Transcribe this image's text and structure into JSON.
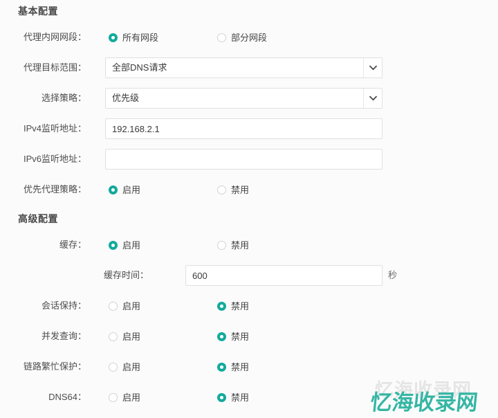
{
  "sections": {
    "basic": {
      "title": "基本配置",
      "rows": {
        "proxy_lan": {
          "label": "代理内网网段：",
          "options": [
            {
              "label": "所有网段",
              "selected": true
            },
            {
              "label": "部分网段",
              "selected": false
            }
          ]
        },
        "proxy_target": {
          "label": "代理目标范围：",
          "value": "全部DNS请求",
          "arrow_icon": "chevron-down-icon"
        },
        "policy": {
          "label": "选择策略：",
          "value": "优先级",
          "arrow_icon": "chevron-down-icon"
        },
        "ipv4": {
          "label": "IPv4监听地址：",
          "value": "192.168.2.1",
          "placeholder": ""
        },
        "ipv6": {
          "label": "IPv6监听地址：",
          "value": "",
          "placeholder": ""
        },
        "priority_proxy": {
          "label": "优先代理策略：",
          "options": [
            {
              "label": "启用",
              "selected": true
            },
            {
              "label": "禁用",
              "selected": false
            }
          ]
        }
      }
    },
    "advanced": {
      "title": "高级配置",
      "rows": {
        "cache": {
          "label": "缓存：",
          "options": [
            {
              "label": "启用",
              "selected": true
            },
            {
              "label": "禁用",
              "selected": false
            }
          ]
        },
        "cache_time": {
          "label": "缓存时间：",
          "value": "600",
          "unit": "秒"
        },
        "session_keep": {
          "label": "会话保持：",
          "options": [
            {
              "label": "启用",
              "selected": false
            },
            {
              "label": "禁用",
              "selected": true
            }
          ]
        },
        "concurrent_query": {
          "label": "并发查询：",
          "options": [
            {
              "label": "启用",
              "selected": false
            },
            {
              "label": "禁用",
              "selected": true
            }
          ]
        },
        "link_busy": {
          "label": "链路繁忙保护：",
          "options": [
            {
              "label": "启用",
              "selected": false
            },
            {
              "label": "禁用",
              "selected": true
            }
          ]
        },
        "dns64": {
          "label": "DNS64：",
          "options": [
            {
              "label": "启用",
              "selected": false
            },
            {
              "label": "禁用",
              "selected": true
            }
          ]
        }
      }
    }
  },
  "watermark": {
    "main_text": "忆海收录网",
    "ghost_text": "忆海收录网",
    "color": "#35b6a4"
  },
  "colors": {
    "accent": "#13aa9c",
    "background": "#fbfbfb",
    "border": "#e0e0e0",
    "label_text": "#4d4d4d"
  }
}
